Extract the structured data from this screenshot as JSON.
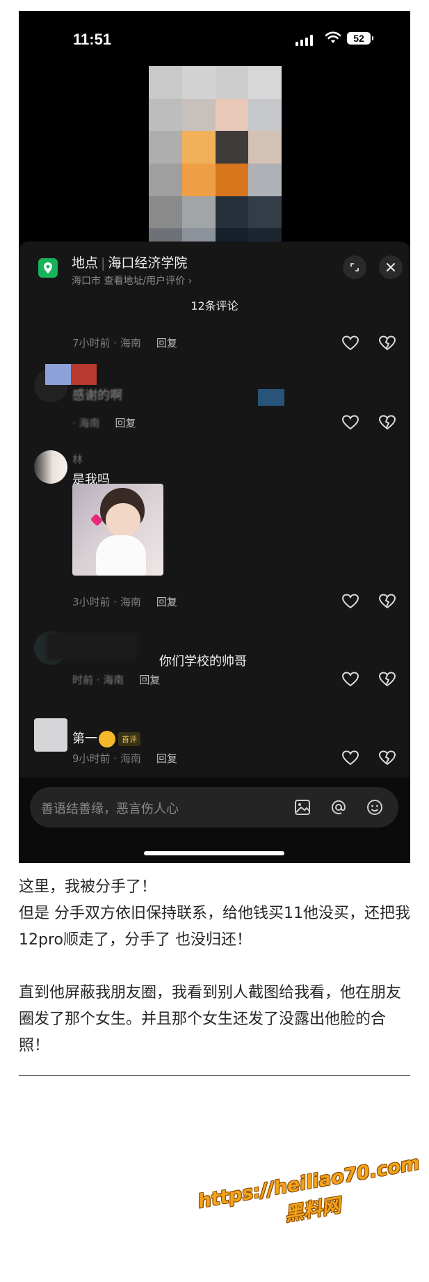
{
  "status_bar": {
    "time": "11:51",
    "battery": "52"
  },
  "location": {
    "prefix": "地点",
    "name": "海口经济学院",
    "sub": "海口市 查看地址/用户评价 ›"
  },
  "comments_count": "12条评论",
  "comments": [
    {
      "meta": "7小时前 · 海南",
      "reply": "回复"
    },
    {
      "text": "感谢的啊",
      "meta": "· 海南",
      "reply": "回复"
    },
    {
      "user": "林",
      "text": "是我吗",
      "meta": "3小时前 · 海南",
      "reply": "回复"
    },
    {
      "text": "你们学校的帅哥",
      "meta": "时前 · 海南",
      "reply": "回复"
    },
    {
      "text": "第一",
      "badge": "首评",
      "meta": "9小时前 · 海南",
      "reply": "回复"
    }
  ],
  "input": {
    "placeholder": "善语结善缘，恶言伤人心"
  },
  "icons": [
    "location-icon",
    "expand-icon",
    "close-icon",
    "heart-icon",
    "dislike-icon",
    "image-icon",
    "at-icon",
    "emoji-icon"
  ],
  "colors": {
    "accent_green": "#17b35b",
    "watermark": "#f3a31a"
  },
  "article": {
    "p1": "这里，我被分手了！",
    "p2": "但是 分手双方依旧保持联系，给他钱买11他没买，还把我12pro顺走了，分手了 也没归还！",
    "p3": "直到他屏蔽我朋友圈，我看到别人截图给我看，他在朋友圈发了那个女生。并且那个女生还发了没露出他脸的合照！"
  },
  "watermark": {
    "url": "https://heiliao70.com",
    "name": "黑料网"
  }
}
